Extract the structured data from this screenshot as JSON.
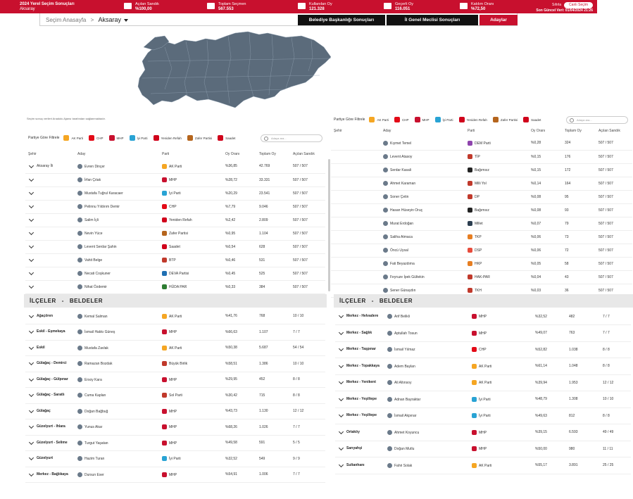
{
  "header": {
    "title": "2024 Yerel Seçim Sonuçları",
    "subtitle": "Aksaray",
    "stats": [
      {
        "label": "Açılan Sandık",
        "value": "%100,00"
      },
      {
        "label": "Toplam Seçmen",
        "value": "567.553"
      },
      {
        "label": "Kullanılan Oy",
        "value": "121.328"
      },
      {
        "label": "Geçerli Oy",
        "value": "116.051"
      },
      {
        "label": "Katılım Oranı",
        "value": "%72,50"
      }
    ],
    "live_label": "Sıfırla",
    "live_pill": "Canlı Seçim",
    "last_update": "Son Güncel Veri: 01/04/2024 21:26"
  },
  "nav": {
    "home": "Seçim Anasayfa",
    "sep": ">",
    "city": "Aksaray",
    "btn_mayor": "Belediye Başkanlığı Sonuçları",
    "btn_council": "İl Genel Meclisi Sonuçları",
    "btn_candidates": "Adaylar"
  },
  "map_note": "Seçim sonuç verileri Anadolu Ajansı tarafından sağlanmaktadır.",
  "filter": {
    "label": "Partiye Göre Filtrele",
    "chips": [
      {
        "name": "AK Parti",
        "color": "#f5a623"
      },
      {
        "name": "CHP",
        "color": "#e30a17"
      },
      {
        "name": "MHP",
        "color": "#c8102e"
      },
      {
        "name": "İyi Parti",
        "color": "#29a3d4"
      },
      {
        "name": "Yeniden Refah",
        "color": "#d0021b"
      },
      {
        "name": "Zafer Partisi",
        "color": "#b5651d"
      },
      {
        "name": "Saadet",
        "color": "#d0021b"
      }
    ],
    "search_placeholder": "Adaya ara..."
  },
  "table_headers": {
    "city": "Şehir",
    "candidate": "Aday",
    "party": "Parti",
    "ratio": "Oy Oranı",
    "total": "Toplam Oy",
    "boxes": "Açılan Sandık"
  },
  "main_table": [
    {
      "city": "Aksaray İli",
      "name": "Evren Dinçer",
      "party": "AK Parti",
      "color": "#f5a623",
      "ratio": "%36,85",
      "total": "42.769",
      "boxes": "507 / 507"
    },
    {
      "city": "",
      "name": "İrfan Çıtak",
      "party": "MHP",
      "color": "#c8102e",
      "ratio": "%28,72",
      "total": "33.331",
      "boxes": "507 / 507"
    },
    {
      "city": "",
      "name": "Mustafa Tuğrul Karacaer",
      "party": "İyi Parti",
      "color": "#29a3d4",
      "ratio": "%20,29",
      "total": "23.541",
      "boxes": "507 / 507"
    },
    {
      "city": "",
      "name": "Pelinnu Yıldırım Demir",
      "party": "CHP",
      "color": "#e30a17",
      "ratio": "%7,79",
      "total": "9.046",
      "boxes": "507 / 507"
    },
    {
      "city": "",
      "name": "Salim İçli",
      "party": "Yeniden Refah",
      "color": "#d0021b",
      "ratio": "%2,42",
      "total": "2.809",
      "boxes": "507 / 507"
    },
    {
      "city": "",
      "name": "Nevin Yüce",
      "party": "Zafer Partisi",
      "color": "#b5651d",
      "ratio": "%0,95",
      "total": "1.104",
      "boxes": "507 / 507"
    },
    {
      "city": "",
      "name": "Levent Serdar Şahin",
      "party": "Saadet",
      "color": "#d0021b",
      "ratio": "%0,54",
      "total": "628",
      "boxes": "507 / 507"
    },
    {
      "city": "",
      "name": "Vahit Belge",
      "party": "BTP",
      "color": "#c0392b",
      "ratio": "%0,46",
      "total": "531",
      "boxes": "507 / 507"
    },
    {
      "city": "",
      "name": "Necati Coşkuner",
      "party": "DEVA Partisi",
      "color": "#1f6fb2",
      "ratio": "%0,45",
      "total": "525",
      "boxes": "507 / 507"
    },
    {
      "city": "",
      "name": "Nihat Özdemir",
      "party": "HÜDA PAR",
      "color": "#2e7d32",
      "ratio": "%0,33",
      "total": "384",
      "boxes": "507 / 507"
    }
  ],
  "right_filter_label": "Partiye Göre Filtrele",
  "right_search_placeholder": "Adaya ara...",
  "right_table": [
    {
      "name": "Kıymet Temel",
      "party": "DEM Parti",
      "color": "#8e44ad",
      "ratio": "%0,28",
      "total": "324",
      "boxes": "507 / 507"
    },
    {
      "name": "Levent Atasoy",
      "party": "TİP",
      "color": "#c0392b",
      "ratio": "%0,15",
      "total": "176",
      "boxes": "507 / 507"
    },
    {
      "name": "Serdar Kasali",
      "party": "Bağımsız",
      "color": "#222222",
      "ratio": "%0,15",
      "total": "172",
      "boxes": "507 / 507"
    },
    {
      "name": "Ahmet Karaman",
      "party": "Milli Yol",
      "color": "#c0392b",
      "ratio": "%0,14",
      "total": "164",
      "boxes": "507 / 507"
    },
    {
      "name": "Soner Çetin",
      "party": "DP",
      "color": "#c0392b",
      "ratio": "%0,08",
      "total": "95",
      "boxes": "507 / 507"
    },
    {
      "name": "Hasan Hüseyin Oruç",
      "party": "Bağımsız",
      "color": "#222222",
      "ratio": "%0,08",
      "total": "93",
      "boxes": "507 / 507"
    },
    {
      "name": "Murat Erdoğan",
      "party": "Millet",
      "color": "#2c3e50",
      "ratio": "%0,07",
      "total": "79",
      "boxes": "507 / 507"
    },
    {
      "name": "Saliha Atmaca",
      "party": "TKP",
      "color": "#e67e22",
      "ratio": "%0,06",
      "total": "73",
      "boxes": "507 / 507"
    },
    {
      "name": "Öncü Uysal",
      "party": "DSP",
      "color": "#e74c3c",
      "ratio": "%0,06",
      "total": "72",
      "boxes": "507 / 507"
    },
    {
      "name": "Fati Beyazdıma",
      "party": "HKP",
      "color": "#e67e22",
      "ratio": "%0,05",
      "total": "58",
      "boxes": "507 / 507"
    },
    {
      "name": "Feyruze İpek Gültekin",
      "party": "HAK-PAR",
      "color": "#c0392b",
      "ratio": "%0,04",
      "total": "43",
      "boxes": "507 / 507"
    },
    {
      "name": "Sener Günaydın",
      "party": "TKH",
      "color": "#c0392b",
      "ratio": "%0,03",
      "total": "36",
      "boxes": "507 / 507"
    }
  ],
  "sections": {
    "ilceler": "İLÇELER",
    "dash": "-",
    "beldeler": "BELDELER"
  },
  "left_towns": [
    {
      "town": "Ağaçören",
      "name": "Kemal Salman",
      "party": "AK Parti",
      "color": "#f5a623",
      "ratio": "%41,76",
      "total": "768",
      "boxes": "10 / 10"
    },
    {
      "town": "Eskil - Eşmekaya",
      "name": "İsmail Hakkı Güneş",
      "party": "MHP",
      "color": "#c8102e",
      "ratio": "%66,63",
      "total": "1.107",
      "boxes": "7 / 7"
    },
    {
      "town": "Eskil",
      "name": "Mustafa Zavlak",
      "party": "AK Parti",
      "color": "#f5a623",
      "ratio": "%50,38",
      "total": "5.687",
      "boxes": "54 / 54"
    },
    {
      "town": "Gülağaç - Demirci",
      "name": "Ramazan Bozdak",
      "party": "Büyük Birlik",
      "color": "#c0392b",
      "ratio": "%58,51",
      "total": "1.386",
      "boxes": "10 / 10"
    },
    {
      "town": "Gülağaç - Gülpınar",
      "name": "Ersoy Kara",
      "party": "MHP",
      "color": "#c8102e",
      "ratio": "%29,95",
      "total": "452",
      "boxes": "8 / 8"
    },
    {
      "town": "Gülağaç - Saratlı",
      "name": "Cuma Kaplan",
      "party": "Sol Parti",
      "color": "#c0392b",
      "ratio": "%30,42",
      "total": "715",
      "boxes": "8 / 8"
    },
    {
      "town": "Gülağaç",
      "name": "Doğan Bağbuğ",
      "party": "MHP",
      "color": "#c8102e",
      "ratio": "%43,73",
      "total": "1.130",
      "boxes": "12 / 12"
    },
    {
      "town": "Güzelyurt - Ihlara",
      "name": "Yunus Akar",
      "party": "MHP",
      "color": "#c8102e",
      "ratio": "%68,26",
      "total": "1.026",
      "boxes": "7 / 7"
    },
    {
      "town": "Güzelyurt - Selime",
      "name": "Turgut Yaşatan",
      "party": "MHP",
      "color": "#c8102e",
      "ratio": "%49,58",
      "total": "591",
      "boxes": "5 / 5"
    },
    {
      "town": "Güzelyurt",
      "name": "Hazim Turan",
      "party": "İyi Parti",
      "color": "#29a3d4",
      "ratio": "%32,52",
      "total": "549",
      "boxes": "9 / 9"
    },
    {
      "town": "Merkez - Bağlıkaya",
      "name": "Dursun Eser",
      "party": "MHP",
      "color": "#c8102e",
      "ratio": "%54,91",
      "total": "1.006",
      "boxes": "7 / 7"
    }
  ],
  "right_towns": [
    {
      "town": "Merkez - Helvadere",
      "name": "Arif Belikli",
      "party": "MHP",
      "color": "#c8102e",
      "ratio": "%32,52",
      "total": "482",
      "boxes": "7 / 7"
    },
    {
      "town": "Merkez - Sağlık",
      "name": "Aptullah Tosun",
      "party": "MHP",
      "color": "#c8102e",
      "ratio": "%49,07",
      "total": "763",
      "boxes": "7 / 7"
    },
    {
      "town": "Merkez - Taşpınar",
      "name": "İsmail Yılmaz",
      "party": "CHP",
      "color": "#e30a17",
      "ratio": "%52,82",
      "total": "1.038",
      "boxes": "8 / 8"
    },
    {
      "town": "Merkez - Topakkaya",
      "name": "Adem Baylan",
      "party": "AK Parti",
      "color": "#f5a623",
      "ratio": "%61,14",
      "total": "1.048",
      "boxes": "8 / 8"
    },
    {
      "town": "Merkez - Yenikent",
      "name": "Ali Altınsoy",
      "party": "AK Parti",
      "color": "#f5a623",
      "ratio": "%39,94",
      "total": "1.953",
      "boxes": "12 / 12"
    },
    {
      "town": "Merkez - Yeşiltepe",
      "name": "Adnan Bayraktar",
      "party": "İyi Parti",
      "color": "#29a3d4",
      "ratio": "%48,79",
      "total": "1.308",
      "boxes": "10 / 10"
    },
    {
      "town": "Merkez - Yeşiltepe",
      "name": "İsmail Akpınar",
      "party": "İyi Parti",
      "color": "#29a3d4",
      "ratio": "%49,63",
      "total": "812",
      "boxes": "8 / 8"
    },
    {
      "town": "Ortaköy",
      "name": "Ahmet Koyuncu",
      "party": "MHP",
      "color": "#c8102e",
      "ratio": "%39,15",
      "total": "6.593",
      "boxes": "49 / 49"
    },
    {
      "town": "Sarıyahşi",
      "name": "Doğan Mutlu",
      "party": "MHP",
      "color": "#c8102e",
      "ratio": "%50,00",
      "total": "980",
      "boxes": "11 / 11"
    },
    {
      "town": "Sultanhanı",
      "name": "Fahri Solak",
      "party": "AK Parti",
      "color": "#f5a623",
      "ratio": "%55,17",
      "total": "3.891",
      "boxes": "25 / 25"
    }
  ],
  "colors": {
    "brand": "#c8102e",
    "dark": "#111111",
    "map": "#5b6b7b"
  }
}
